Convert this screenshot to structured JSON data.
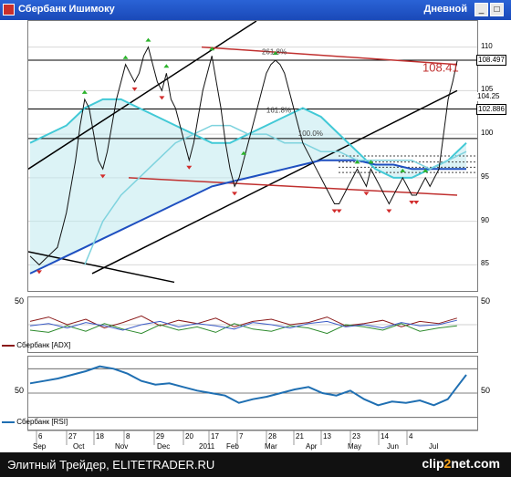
{
  "window": {
    "title": "Сбербанк Ишимоку",
    "period": "Дневной",
    "buttons": [
      "_",
      "□"
    ]
  },
  "chart_data": [
    {
      "type": "line",
      "title": "",
      "ylim": [
        82,
        113
      ],
      "yticks_right": [
        "110",
        "105",
        "100",
        "95",
        "90",
        "85"
      ],
      "price_tags": [
        "108.497",
        "102.886",
        "104.25"
      ],
      "last_price_label": "108.41",
      "fib_labels": [
        "261.8%",
        "161.8%",
        "100.0%"
      ],
      "series": [
        {
          "name": "",
          "x": [
            0,
            5,
            10,
            15,
            20,
            25,
            30,
            35,
            40,
            45,
            50,
            55,
            60,
            65,
            70,
            75,
            80,
            85,
            90,
            95,
            100,
            105,
            110,
            115,
            120,
            125,
            130,
            135,
            140,
            145,
            150,
            155,
            160,
            165,
            170,
            175,
            180,
            185,
            190,
            195,
            200,
            205,
            210,
            215,
            220,
            225,
            230,
            235
          ],
          "values": [
            86,
            85.5,
            85,
            85.5,
            86,
            86.5,
            87,
            89,
            91,
            94,
            97,
            101,
            104,
            103,
            100,
            97,
            96,
            98,
            101,
            104,
            106,
            108,
            107,
            106,
            107,
            109,
            110,
            108,
            106,
            105,
            107,
            104,
            103,
            101,
            99,
            97,
            99,
            102,
            105,
            107,
            109,
            106,
            103,
            99,
            96,
            94,
            95,
            97
          ]
        },
        {
          "name": "",
          "x": [
            235,
            240,
            245,
            250,
            255,
            260,
            265,
            270,
            275,
            280,
            285,
            290,
            295,
            300,
            305,
            310,
            315,
            320,
            325,
            330,
            335,
            340,
            345,
            350,
            355,
            360,
            365,
            370,
            375,
            380,
            385,
            390,
            395,
            400,
            405,
            410,
            415,
            420,
            425,
            430,
            435,
            440,
            445,
            450,
            455,
            460,
            465,
            470
          ],
          "values": [
            97,
            99,
            101,
            103,
            105,
            107,
            108,
            108.5,
            108,
            107,
            105,
            103,
            101,
            99,
            98,
            97,
            96,
            95,
            94,
            93,
            92,
            92,
            93,
            94,
            95,
            96,
            95,
            94,
            96,
            95,
            94,
            93,
            92,
            93,
            94,
            95,
            94,
            93,
            93,
            94,
            95,
            94,
            95,
            96,
            100,
            104,
            106,
            108.4
          ]
        },
        {
          "name": "",
          "x": [
            0,
            20,
            40,
            60,
            80,
            100,
            120,
            140,
            160,
            180,
            200,
            220,
            240,
            260,
            280,
            300,
            320,
            340,
            360,
            380,
            400,
            420,
            440,
            460,
            480
          ],
          "values": [
            99,
            100,
            101,
            103,
            104,
            104,
            103,
            102,
            101,
            100,
            99,
            99,
            100,
            101,
            102,
            103,
            102,
            100,
            98,
            96,
            95,
            95,
            96,
            97,
            99
          ]
        },
        {
          "name": "",
          "x": [
            0,
            20,
            40,
            60,
            80,
            100,
            120,
            140,
            160,
            180,
            200,
            220,
            240,
            260,
            280,
            300,
            320,
            340,
            360,
            380,
            400,
            420,
            440,
            460,
            480
          ],
          "values": [
            84,
            85,
            86,
            87,
            88,
            89,
            90,
            91,
            92,
            93,
            94,
            94.5,
            95,
            95.5,
            96,
            96.5,
            97,
            97,
            97,
            96.5,
            96.5,
            96,
            96,
            96,
            96
          ]
        },
        {
          "name": "",
          "x": [
            60,
            80,
            100,
            120,
            140,
            160,
            180,
            200,
            220,
            240,
            260,
            280,
            300,
            320,
            340,
            360,
            380,
            400,
            420,
            440,
            460,
            480
          ],
          "values": [
            85,
            90,
            93,
            95,
            97,
            99,
            100,
            101,
            101,
            100,
            100,
            99,
            99,
            98,
            98,
            97,
            97,
            97,
            97,
            96,
            97,
            98
          ]
        }
      ]
    },
    {
      "type": "line",
      "title": "Сбербанк [ADX]",
      "ylim": [
        0,
        50
      ],
      "yticks": [
        "50",
        "50"
      ],
      "series": [
        {
          "name": "",
          "x": [
            0,
            20,
            40,
            60,
            80,
            100,
            120,
            140,
            160,
            180,
            200,
            220,
            240,
            260,
            280,
            300,
            320,
            340,
            360,
            380,
            400,
            420,
            440,
            460
          ],
          "values": [
            28,
            32,
            25,
            30,
            22,
            27,
            33,
            24,
            29,
            26,
            31,
            23,
            28,
            30,
            25,
            27,
            32,
            24,
            26,
            29,
            23,
            28,
            26,
            31
          ]
        },
        {
          "name": "",
          "x": [
            0,
            20,
            40,
            60,
            80,
            100,
            120,
            140,
            160,
            180,
            200,
            220,
            240,
            260,
            280,
            300,
            320,
            340,
            360,
            380,
            400,
            420,
            440,
            460
          ],
          "values": [
            20,
            18,
            24,
            19,
            26,
            21,
            17,
            25,
            20,
            23,
            18,
            26,
            21,
            19,
            24,
            22,
            17,
            25,
            23,
            20,
            26,
            19,
            22,
            24
          ]
        },
        {
          "name": "",
          "x": [
            0,
            20,
            40,
            60,
            80,
            100,
            120,
            140,
            160,
            180,
            200,
            220,
            240,
            260,
            280,
            300,
            320,
            340,
            360,
            380,
            400,
            420,
            440,
            460
          ],
          "values": [
            24,
            26,
            22,
            27,
            24,
            20,
            25,
            28,
            23,
            26,
            24,
            21,
            27,
            25,
            22,
            26,
            28,
            23,
            25,
            22,
            27,
            24,
            25,
            29
          ]
        }
      ]
    },
    {
      "type": "line",
      "title": "Сбербанк [RSI]",
      "ylim": [
        20,
        80
      ],
      "yticks": [
        "50",
        "50"
      ],
      "series": [
        {
          "name": "",
          "x": [
            0,
            15,
            30,
            45,
            60,
            75,
            90,
            105,
            120,
            135,
            150,
            165,
            180,
            195,
            210,
            225,
            240,
            255,
            270,
            285,
            300,
            315,
            330,
            345,
            360,
            375,
            390,
            405,
            420,
            435,
            450,
            460,
            470
          ],
          "values": [
            58,
            60,
            62,
            65,
            68,
            72,
            70,
            66,
            60,
            57,
            58,
            55,
            52,
            50,
            48,
            42,
            45,
            47,
            50,
            53,
            55,
            50,
            48,
            52,
            45,
            40,
            43,
            42,
            44,
            40,
            45,
            55,
            65
          ]
        }
      ]
    }
  ],
  "x_axis": {
    "day_labels": [
      "6",
      "27",
      "18",
      "8",
      "29",
      "20",
      "17",
      "7",
      "28",
      "21",
      "13",
      "23",
      "14",
      "4"
    ],
    "month_labels": [
      "Sep",
      "Oct",
      "Nov",
      "Dec",
      "2011",
      "Feb",
      "Mar",
      "Apr",
      "May",
      "Jun",
      "Jul"
    ]
  },
  "footer": {
    "text": "Элитный Трейдер, ELITETRADER.RU",
    "logo_prefix": "clip",
    "logo_two": "2",
    "logo_suffix": "net.com"
  }
}
